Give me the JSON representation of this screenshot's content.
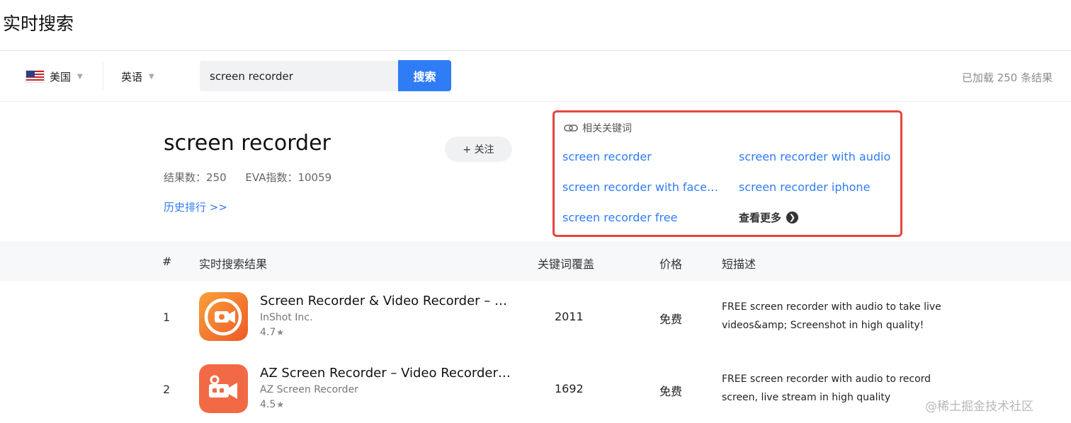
{
  "page_title": "实时搜索",
  "filters": {
    "country": "美国",
    "language": "英语",
    "search_value": "screen recorder",
    "search_button": "搜索",
    "loaded_status": "已加载 250 条结果"
  },
  "keyword_summary": {
    "keyword": "screen recorder",
    "results_label": "结果数：250",
    "eva_label": "EVA指数：10059",
    "history_link": "历史排行 >>",
    "follow_button": "+ 关注"
  },
  "related_keywords": {
    "header": "相关关键词",
    "items": [
      "screen recorder",
      "screen recorder with audio",
      "screen recorder with face…",
      "screen recorder iphone",
      "screen recorder free"
    ],
    "view_more": "查看更多"
  },
  "table": {
    "columns": [
      "#",
      "实时搜索结果",
      "关键词覆盖",
      "价格",
      "短描述"
    ],
    "rows": [
      {
        "rank": "1",
        "title": "Screen Recorder & Video Recorder – X…",
        "developer": "InShot Inc.",
        "rating": "4.7",
        "coverage": "2011",
        "price": "免费",
        "description": "FREE screen recorder with audio to take live videos&amp; Screenshot in high quality!",
        "icon": "video-camera-record-icon",
        "icon_color": "#f0672d"
      },
      {
        "rank": "2",
        "title": "AZ Screen Recorder – Video Recorder, …",
        "developer": "AZ Screen Recorder",
        "rating": "4.5",
        "coverage": "1692",
        "price": "免费",
        "description": "FREE screen recorder with audio to record screen, live stream in high quality",
        "icon": "video-camera-icon",
        "icon_color": "#f26a45"
      }
    ]
  },
  "watermark": "@稀土掘金技术社区",
  "colors": {
    "accent": "#2f7cf6",
    "highlight_border": "#e5473b"
  }
}
